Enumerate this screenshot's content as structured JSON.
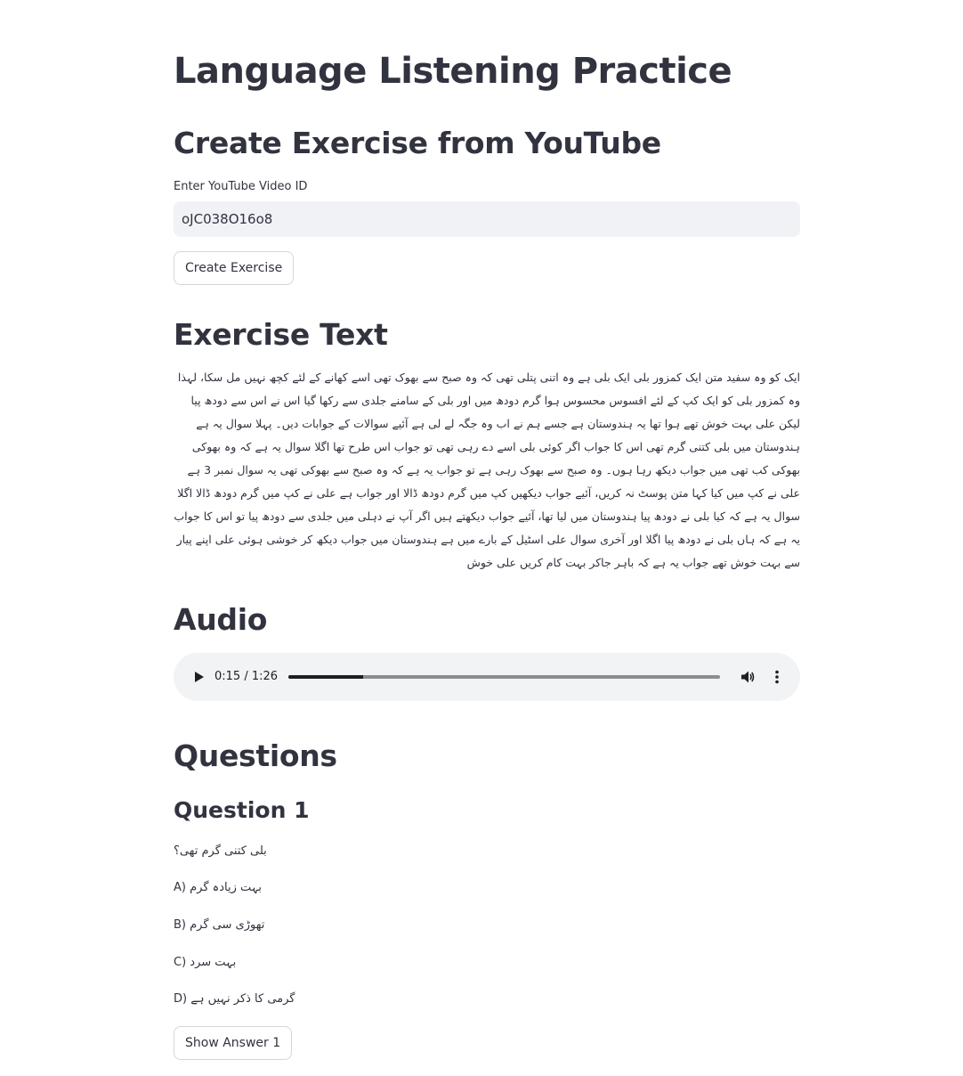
{
  "page_title": "Language Listening Practice",
  "create_section": {
    "heading": "Create Exercise from YouTube",
    "input_label": "Enter YouTube Video ID",
    "input_value": "oJC038O16o8",
    "button_label": "Create Exercise"
  },
  "exercise": {
    "heading": "Exercise Text",
    "text": "ایک کو وہ سفید متن ایک کمزور بلی ایک بلی ہے وہ اتنی پتلی تھی کہ وہ صبح سے بھوک تھی اسے کھانے کے لئے کچھ نہیں مل سکا، لہذا وہ کمزور بلی کو ایک کپ کے لئے افسوس محسوس ہوا گرم دودھ میں اور بلی کے سامنے جلدی سے رکھا گیا اس نے اس سے دودھ پیا لیکن علی بہت خوش تھے ہوا تھا یہ ہندوستان ہے جسے ہم نے اب وہ جگہ لے لی ہے آئیے سوالات کے جوابات دیں۔ پہلا سوال یہ ہے ہندوستان میں بلی کتنی گرم تھی اس کا جواب اگر کوئی بلی اسے دے رہی تھی تو جواب اس طرح تھا اگلا سوال یہ ہے کہ وہ بھوکی بھوکی کب تھی میں جواب دیکھ رہا ہوں۔ وہ صبح سے بھوک رہی ہے تو جواب یہ ہے کہ وہ صبح سے بھوکی تھی یہ سوال نمبر 3 ہے علی نے کپ میں کیا کہا متن پوسٹ نہ کریں، آئیے جواب دیکھیں کپ میں گرم دودھ ڈالا اور جواب ہے علی نے کپ میں گرم دودھ ڈالا اگلا سوال یہ ہے کہ کیا بلی نے دودھ پیا ہندوستان میں لیا تھا، آئیے جواب دیکھتے ہیں اگر آپ نے دہلی میں جلدی سے دودھ پیا تو اس کا جواب یہ ہے کہ ہاں بلی نے دودھ پیا اگلا اور آخری سوال علی اسٹیل کے بارے میں ہے ہندوستان میں جواب دیکھ کر خوشی ہوئی علی اپنے پیار سے بہت خوش تھے جواب یہ ہے کہ باہر جاکر بہت کام کریں علی خوش"
  },
  "audio": {
    "heading": "Audio",
    "time_display": "0:15 / 1:26",
    "progress_fraction": 0.174
  },
  "questions": {
    "heading": "Questions",
    "items": [
      {
        "title": "Question 1",
        "prompt": "بلی کتنی گرم تھی؟",
        "options": [
          "A) بہت زیادہ گرم",
          "B) تھوڑی سی گرم",
          "C) بہت سرد",
          "D) گرمی کا ذکر نہیں ہے"
        ],
        "button_label": "Show Answer 1"
      }
    ]
  },
  "icons": {
    "play": "play-icon",
    "volume": "volume-icon",
    "more": "more-vertical-icon"
  },
  "colors": {
    "text": "#31333f",
    "input_bg": "#f0f2f6",
    "audio_bg": "#f1f3f4",
    "button_border": "#d5d6da"
  }
}
